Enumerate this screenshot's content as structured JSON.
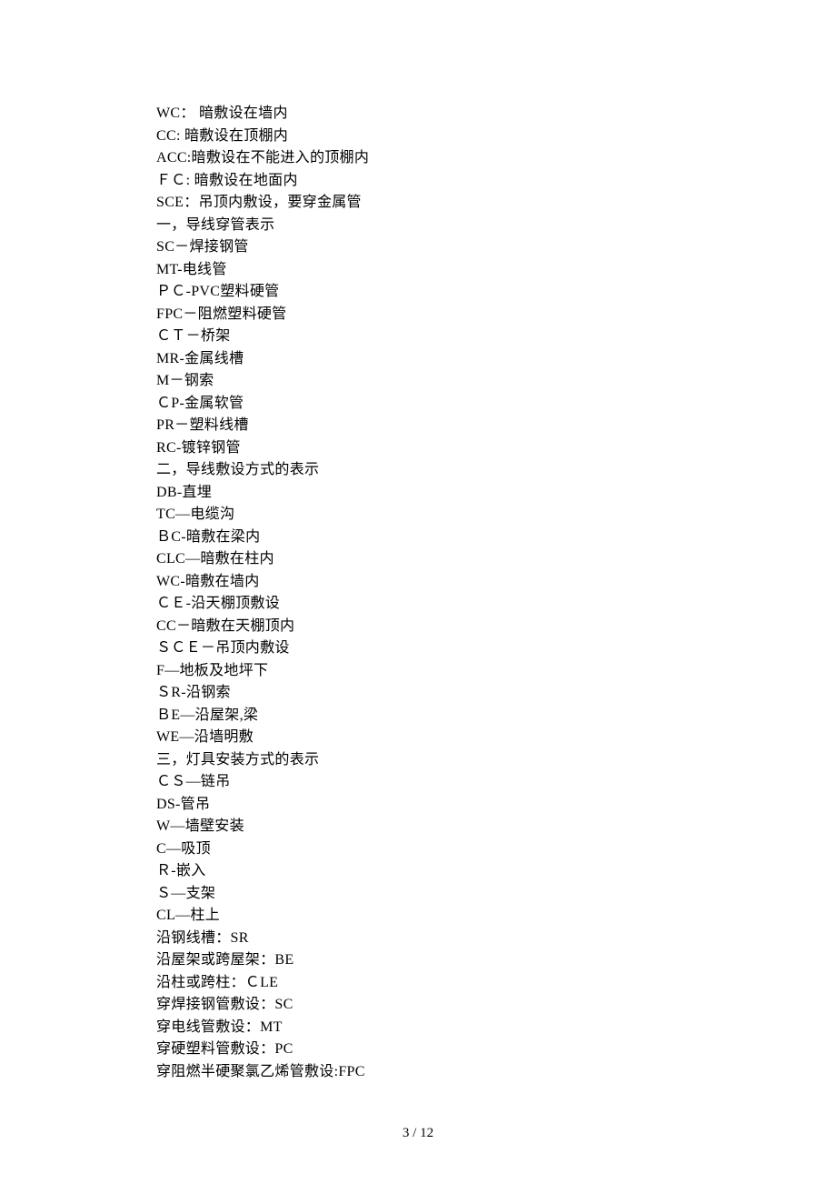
{
  "lines": [
    "WC： 暗敷设在墙内",
    "CC: 暗敷设在顶棚内",
    "ACC:暗敷设在不能进入的顶棚内",
    "ＦＣ: 暗敷设在地面内",
    "SCE：吊顶内敷设，要穿金属管",
    "一，导线穿管表示",
    "SC－焊接钢管",
    "MT-电线管",
    "ＰＣ-PVC塑料硬管",
    "FPC－阻燃塑料硬管",
    "ＣＴ－桥架",
    "MR-金属线槽",
    "M－钢索",
    "ＣP-金属软管",
    "PR－塑料线槽",
    "RC-镀锌钢管",
    "二，导线敷设方式的表示",
    "DB-直埋",
    "TC—电缆沟",
    "ＢC-暗敷在梁内",
    "CLC—暗敷在柱内",
    "WC-暗敷在墙内",
    "ＣＥ-沿天棚顶敷设",
    "CC－暗敷在天棚顶内",
    "ＳＣＥ－吊顶内敷设",
    "F—地板及地坪下",
    "ＳR-沿钢索",
    "ＢE—沿屋架,梁",
    "WE—沿墙明敷",
    "三，灯具安装方式的表示",
    "ＣＳ—链吊",
    "DS-管吊",
    "W—墙壁安装",
    "C—吸顶",
    "Ｒ-嵌入",
    "Ｓ—支架",
    "CL—柱上",
    "沿钢线槽：SR",
    "沿屋架或跨屋架：BE",
    "沿柱或跨柱：ＣLE",
    "穿焊接钢管敷设：SC",
    "穿电线管敷设：MT",
    "穿硬塑料管敷设：PC",
    "穿阻燃半硬聚氯乙烯管敷设:FPC"
  ],
  "page_number": "3 / 12"
}
